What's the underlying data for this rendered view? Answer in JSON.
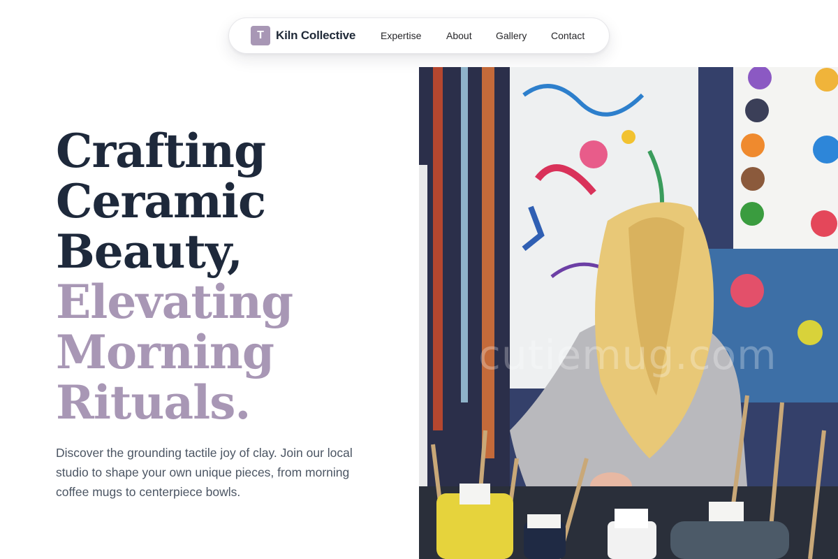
{
  "nav": {
    "brand_initial": "T",
    "brand_name": "Kiln Collective",
    "links": [
      "Expertise",
      "About",
      "Gallery",
      "Contact"
    ]
  },
  "hero": {
    "headline_dark": [
      "Crafting",
      "Ceramic",
      "Beauty,"
    ],
    "headline_light": [
      "Elevating",
      "Morning",
      "Rituals."
    ],
    "description": "Discover the grounding tactile joy of clay. Join our local studio to shape your own unique pieces, from morning coffee mugs to centerpiece bowls.",
    "image_watermark": "cutiemug.com"
  },
  "colors": {
    "accent": "#a897b5",
    "heading": "#1e293b",
    "body_text": "#4b5563"
  }
}
